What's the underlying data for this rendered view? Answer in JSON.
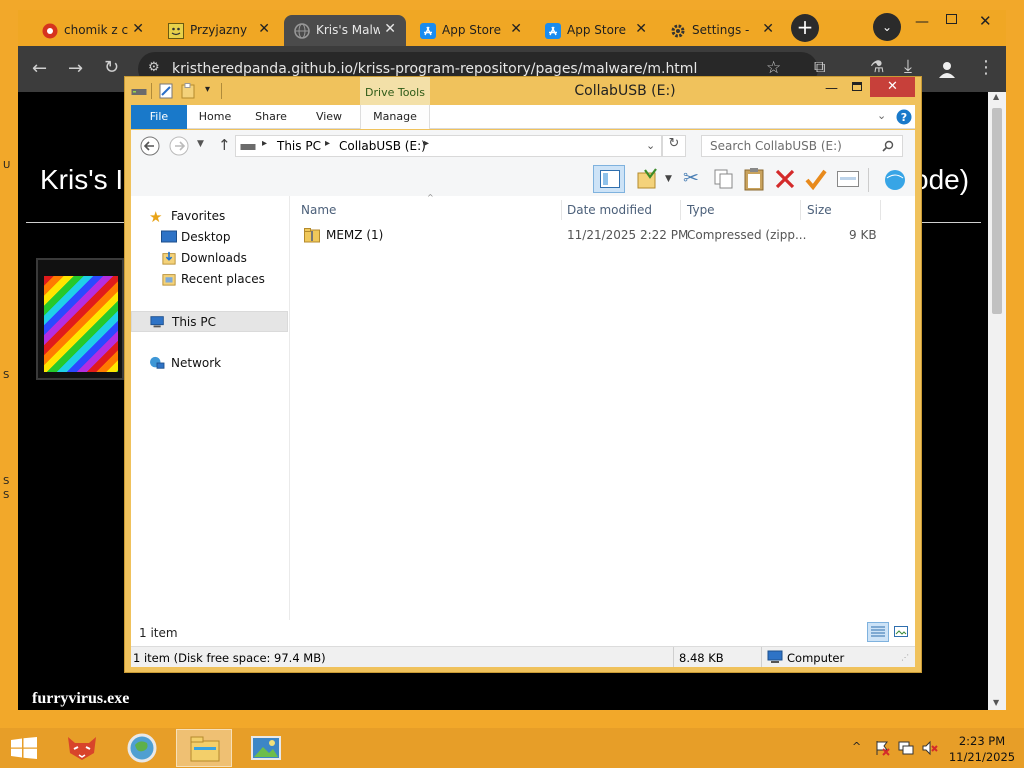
{
  "browser": {
    "tabs": [
      {
        "label": "chomik z c",
        "icon": "chomik-favicon"
      },
      {
        "label": "Przyjazny c",
        "icon": "smiley-favicon"
      },
      {
        "label": "Kris's Malw",
        "icon": "globe-favicon"
      },
      {
        "label": "App Store",
        "icon": "app-store-favicon"
      },
      {
        "label": "App Store",
        "icon": "app-store-favicon"
      },
      {
        "label": "Settings -",
        "icon": "gear-favicon"
      }
    ],
    "new_tab_symbol": "+",
    "url": "kristheredpanda.github.io/kriss-program-repository/pages/malware/m.html"
  },
  "webpage": {
    "heading_left": "Kris's I",
    "heading_right": "ode)",
    "item_title": "furryvirus.exe",
    "left_edge_text": [
      "U",
      "S",
      "S",
      "S"
    ]
  },
  "explorer": {
    "title": "CollabUSB (E:)",
    "contextual_tab": "Drive Tools",
    "ribbon_tabs": [
      "File",
      "Home",
      "Share",
      "View",
      "Manage"
    ],
    "breadcrumb": [
      "This PC",
      "CollabUSB (E:)"
    ],
    "search_placeholder": "Search CollabUSB (E:)",
    "nav": {
      "favorites": "Favorites",
      "desktop": "Desktop",
      "downloads": "Downloads",
      "recent": "Recent places",
      "this_pc": "This PC",
      "network": "Network"
    },
    "columns": [
      "Name",
      "Date modified",
      "Type",
      "Size"
    ],
    "files": [
      {
        "name": "MEMZ (1)",
        "date": "11/21/2025 2:22 PM",
        "type": "Compressed (zipp...",
        "size": "9 KB"
      }
    ],
    "item_count": "1 item",
    "status_left": "1 item (Disk free space: 97.4 MB)",
    "status_size": "8.48 KB",
    "status_location": "Computer"
  },
  "taskbar": {
    "time": "2:23 PM",
    "date": "11/21/2025",
    "tray_chevron": "^"
  },
  "colors": {
    "desktop": "#f2a82a",
    "accent_blue": "#1979ca",
    "window_frame": "#f0c25c",
    "close_red": "#c7403a"
  }
}
